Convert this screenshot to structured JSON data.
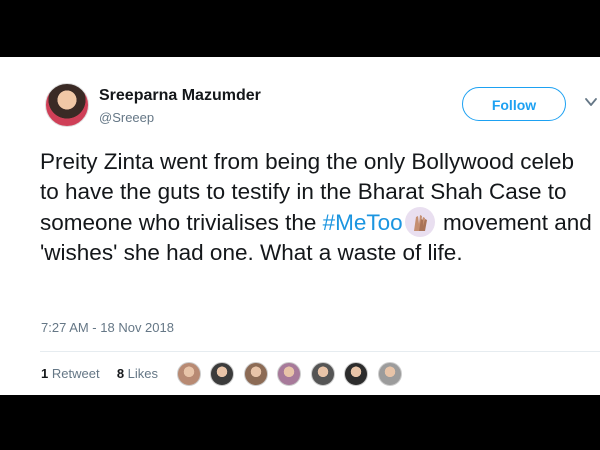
{
  "tweet": {
    "author_name": "Sreeparna Mazumder",
    "handle": "@Sreeep",
    "follow_label": "Follow",
    "text_before_hashtag": "Preity Zinta went from being the only Bollywood celeb to have the guts to testify in the Bharat Shah Case to someone who trivialises the ",
    "hashtag": "#MeToo",
    "text_after_hashtag": " movement and 'wishes' she had one. What a waste of life.",
    "timestamp": "7:27 AM - 18 Nov 2018",
    "retweet_count": "1",
    "retweet_label": "Retweet",
    "like_count": "8",
    "like_label": "Likes",
    "liker_avatar_colors": [
      "#b88a73",
      "#3b3b3b",
      "#8c6b55",
      "#a77a9a",
      "#555555",
      "#2c2c2c",
      "#9c9c9c"
    ]
  },
  "colors": {
    "accent": "#1da1f2",
    "hashtag": "#1b95e0",
    "text": "#14171a",
    "muted": "#657786"
  },
  "icons": {
    "chevron": "chevron-down-icon",
    "emoji": "raised-hands-emoji-icon"
  }
}
